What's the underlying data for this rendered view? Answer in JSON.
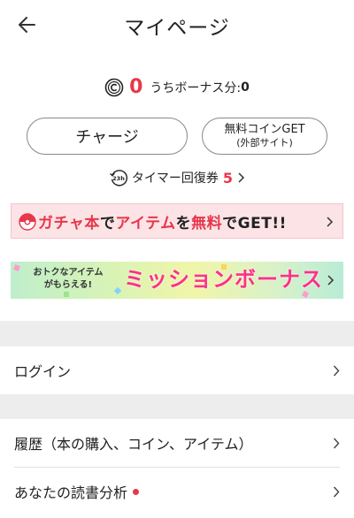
{
  "header": {
    "title": "マイページ",
    "back_icon": "arrow-left-icon"
  },
  "coins": {
    "count": "0",
    "bonus_label": "うちボーナス分:",
    "bonus_value": "0",
    "icon": "coin-icon"
  },
  "buttons": {
    "charge_label": "チャージ",
    "free_coin_label": "無料コインGET",
    "free_coin_sub": "(外部サイト)"
  },
  "timer": {
    "label": "タイマー回復券",
    "count": "5",
    "icon_text": "23h"
  },
  "gacha_banner": {
    "part1": "ガチャ本",
    "part2": "で",
    "part3": "アイテム",
    "part4": "を",
    "part5": "無料",
    "part6": "でGET!!"
  },
  "mission_banner": {
    "small_line1": "おトクなアイテム",
    "small_line2": "がもらえる!",
    "big_text": "ミッションボーナス"
  },
  "menu": {
    "login": "ログイン",
    "history": "履歴（本の購入、コイン、アイテム）",
    "reading_analysis": "あなたの読書分析"
  },
  "colors": {
    "accent_red": "#e8374a",
    "mission_pink": "#ff2f89",
    "gacha_bg": "#fbe3e6"
  }
}
